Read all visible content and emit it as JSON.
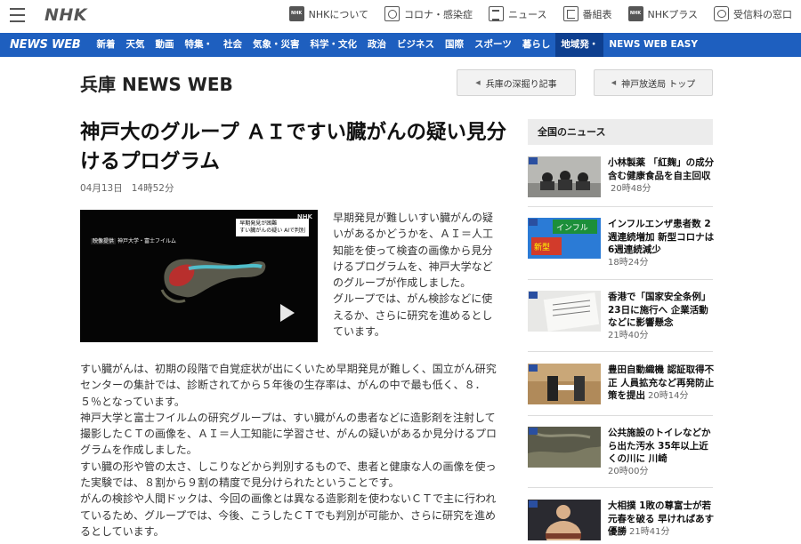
{
  "topbar": {
    "logo": "NHK",
    "links": [
      {
        "label": "NHKについて",
        "icon": "nhk-icon"
      },
      {
        "label": "コロナ・感染症",
        "icon": "corona-icon"
      },
      {
        "label": "ニュース",
        "icon": "news-icon"
      },
      {
        "label": "番組表",
        "icon": "program-guide-icon"
      },
      {
        "label": "NHKプラス",
        "icon": "nhk-plus-icon"
      },
      {
        "label": "受信料の窓口",
        "icon": "tv-icon"
      }
    ]
  },
  "nav": {
    "brand": "NEWS WEB",
    "items": [
      {
        "label": "新着"
      },
      {
        "label": "天気"
      },
      {
        "label": "動画"
      },
      {
        "label": "特集・",
        "caret": true
      },
      {
        "label": "社会"
      },
      {
        "label": "気象・災害"
      },
      {
        "label": "科学・文化"
      },
      {
        "label": "政治"
      },
      {
        "label": "ビジネス"
      },
      {
        "label": "国際"
      },
      {
        "label": "スポーツ"
      },
      {
        "label": "暮らし"
      },
      {
        "label": "地域発・",
        "selected": true
      },
      {
        "label": "NEWS WEB EASY"
      }
    ]
  },
  "header": {
    "title": "兵庫 NEWS WEB",
    "buttons": [
      "兵庫の深掘り記事",
      "神戸放送局 トップ"
    ]
  },
  "article": {
    "title": "神戸大のグループ ＡＩですい臓がんの疑い見分けるプログラム",
    "date": "04月13日",
    "time": "14時52分",
    "video": {
      "caption_left_tag": "映像提供",
      "caption_left": "神戸大学・富士フイルム",
      "caption_right_1": "早期発見が困難",
      "caption_right_2": "すい臓がんの疑い AIで判別",
      "logo": "NHK"
    },
    "lead": "早期発見が難しいすい臓がんの疑いがあるかどうかを、ＡＩ＝人工知能を使って検査の画像から見分けるプログラムを、神戸大学などのグループが作成しました。\nグループでは、がん検診などに使えるか、さらに研究を進めるとしています。",
    "paragraphs": [
      "すい臓がんは、初期の段階で自覚症状が出にくいため早期発見が難しく、国立がん研究センターの集計では、診断されてから５年後の生存率は、がんの中で最も低く、８．５％となっています。",
      "神戸大学と富士フイルムの研究グループは、すい臓がんの患者などに造影剤を注射して撮影したＣＴの画像を、ＡＩ＝人工知能に学習させ、がんの疑いがあるか見分けるプログラムを作成しました。",
      "すい臓の形や管の太さ、しこりなどから判別するもので、患者と健康な人の画像を使った実験では、８割から９割の精度で見分けられたということです。",
      "がんの検診や人間ドックは、今回の画像とは異なる造影剤を使わないＣＴで主に行われているため、グループでは、今後、こうしたＣＴでも判別が可能か、さらに研究を進めるとしています。"
    ]
  },
  "sidebar": {
    "title": "全国のニュース",
    "items": [
      {
        "headline": "小林製薬 「紅麹」の成分含む健康食品を自主回収",
        "time": "20時48分"
      },
      {
        "headline": "インフルエンザ患者数 2週連続増加 新型コロナは6週連続減少",
        "time": "18時24分"
      },
      {
        "headline": "香港で「国家安全条例」23日に施行へ 企業活動などに影響懸念",
        "time": "21時40分"
      },
      {
        "headline": "豊田自動織機 認証取得不正 人員拡充など再発防止策を提出",
        "time": "20時14分"
      },
      {
        "headline": "公共施設のトイレなどから出た汚水 35年以上近くの川に 川崎",
        "time": "20時00分"
      },
      {
        "headline": "大相撲 1敗の尊富士が若元春を破る 早ければあす優勝",
        "time": "21時41分"
      }
    ]
  }
}
